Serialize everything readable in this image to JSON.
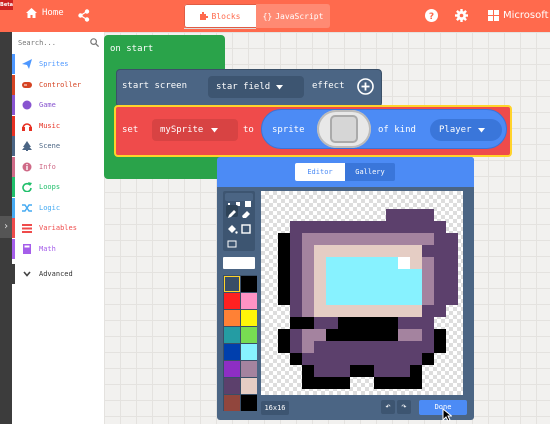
{
  "topbar": {
    "beta": "Beta",
    "home_label": "Home",
    "blocks_label": "Blocks",
    "js_label": "JavaScript",
    "brand": "Microsoft",
    "color": "#ff6a4d"
  },
  "toolbox": {
    "search_placeholder": "Search...",
    "categories": [
      {
        "label": "Sprites",
        "color": "#4c97ff",
        "icon": "paper-plane-icon"
      },
      {
        "label": "Controller",
        "color": "#d54322",
        "icon": "gamepad-icon"
      },
      {
        "label": "Game",
        "color": "#8854d0",
        "icon": "circle-icon"
      },
      {
        "label": "Music",
        "color": "#e63022",
        "icon": "headphones-icon"
      },
      {
        "label": "Scene",
        "color": "#4b6584",
        "icon": "tree-icon"
      },
      {
        "label": "Info",
        "color": "#cf6a87",
        "icon": "info-icon"
      },
      {
        "label": "Loops",
        "color": "#20bf6b",
        "icon": "refresh-icon"
      },
      {
        "label": "Logic",
        "color": "#45aaf2",
        "icon": "shuffle-icon"
      },
      {
        "label": "Variables",
        "color": "#ef4b4b",
        "icon": "list-icon"
      },
      {
        "label": "Math",
        "color": "#a55eea",
        "icon": "calculator-icon"
      }
    ],
    "advanced_label": "Advanced"
  },
  "workspace": {
    "on_start": "on start",
    "start_screen": "start screen",
    "star_field": "star field",
    "effect": "effect",
    "set": "set",
    "variable": "mySprite",
    "to": "to",
    "sprite": "sprite",
    "of_kind": "of kind",
    "kind": "Player"
  },
  "editor": {
    "tab_editor": "Editor",
    "tab_gallery": "Gallery",
    "size": "16x16",
    "done": "Done",
    "palette": [
      "#ffffff",
      "#000000",
      "#ff2121",
      "#ff93c4",
      "#ff8135",
      "#fff609",
      "#249ca3",
      "#78dc52",
      "#003fad",
      "#87f2ff",
      "#8e2ec4",
      "#a4839f",
      "#5c406c",
      "#e5cdc4",
      "#91463d",
      "#000000"
    ],
    "sprite_pixels": [
      "................",
      "..........wwww..",
      "..wwwwwwwwwwwww.",
      ".kwLLLLLLLLLLLww",
      ".kwLbbbbbbbbbwww",
      ".kwLbccccccWbLww",
      ".kwLbccccccccLww",
      ".kwLbccccccccLww",
      ".kwLbccccccccLww",
      "..wLbbbbbbbbbww.",
      "..kkwwkkkkkwww..",
      ".kwLLkkkkkkLLwk.",
      ".kwLwwwwwwwwwwk.",
      "..kwwwwwwwwwwk..",
      "...kwwwkkwwwk...",
      "...kkkk..kkkk..."
    ],
    "pixel_colors": {
      "w": "#5c406c",
      "L": "#a4839f",
      "b": "#e5cdc4",
      "c": "#87f2ff",
      "W": "#ffffff",
      "k": "#000000"
    }
  }
}
